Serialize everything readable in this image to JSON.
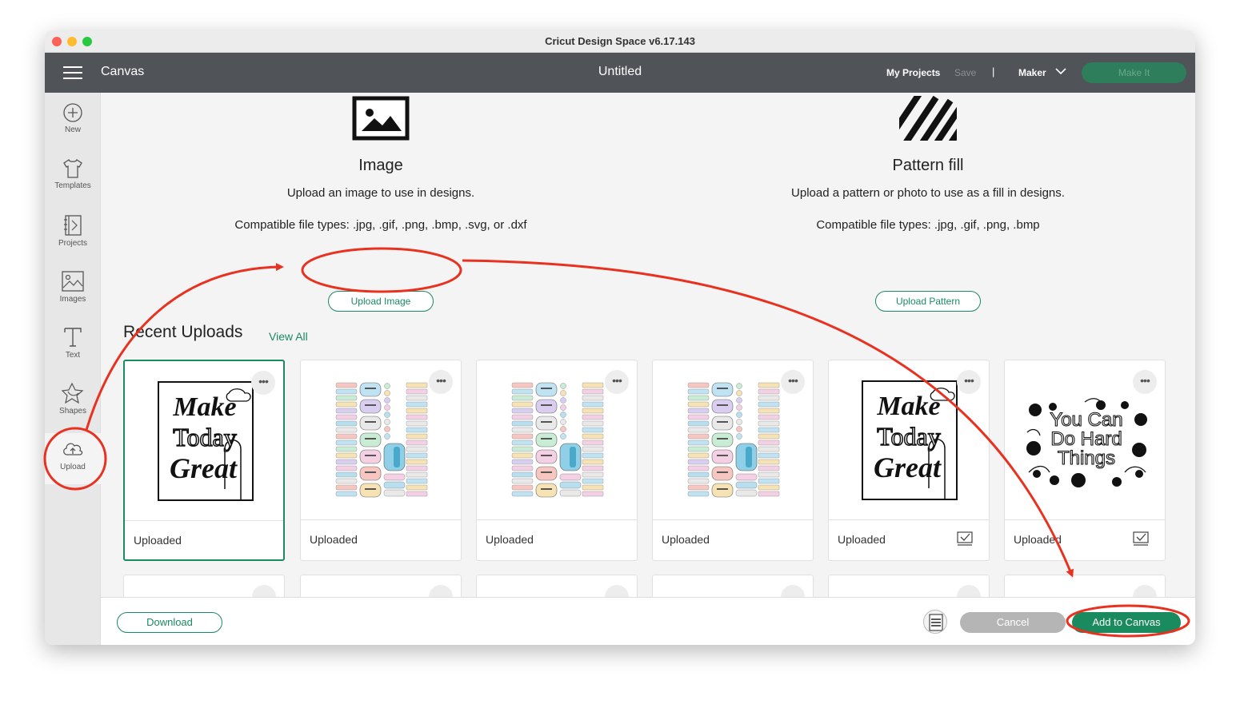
{
  "window": {
    "title": "Cricut Design Space  v6.17.143"
  },
  "header": {
    "section": "Canvas",
    "doc_title": "Untitled",
    "my_projects": "My Projects",
    "save": "Save",
    "separator": "|",
    "machine": "Maker",
    "make_it": "Make It"
  },
  "sidebar": {
    "items": [
      {
        "label": "New",
        "icon": "plus-circle-icon"
      },
      {
        "label": "Templates",
        "icon": "tshirt-icon"
      },
      {
        "label": "Projects",
        "icon": "projects-icon"
      },
      {
        "label": "Images",
        "icon": "images-icon"
      },
      {
        "label": "Text",
        "icon": "text-icon"
      },
      {
        "label": "Shapes",
        "icon": "shapes-icon"
      },
      {
        "label": "Upload",
        "icon": "cloud-upload-icon"
      }
    ]
  },
  "upload_image": {
    "title": "Image",
    "description": "Upload an image to use in designs.",
    "types": "Compatible file types: .jpg, .gif, .png, .bmp, .svg, or .dxf",
    "button": "Upload Image"
  },
  "upload_pattern": {
    "title": "Pattern fill",
    "description": "Upload a pattern or photo to use as a fill in designs.",
    "types": "Compatible file types: .jpg, .gif, .png, .bmp",
    "button": "Upload Pattern"
  },
  "recent": {
    "title": "Recent Uploads",
    "view_all": "View All",
    "tiles": [
      {
        "caption": "Uploaded",
        "art": "Make Today Great",
        "selected": true,
        "checkbox": false
      },
      {
        "caption": "Uploaded",
        "art": "planner stickers",
        "selected": false,
        "checkbox": false
      },
      {
        "caption": "Uploaded",
        "art": "planner stickers",
        "selected": false,
        "checkbox": false
      },
      {
        "caption": "Uploaded",
        "art": "planner stickers",
        "selected": false,
        "checkbox": false
      },
      {
        "caption": "Uploaded",
        "art": "Make Today Great",
        "selected": false,
        "checkbox": true
      },
      {
        "caption": "Uploaded",
        "art": "You Can Do Hard Things",
        "selected": false,
        "checkbox": true
      }
    ],
    "art_text": {
      "make": "Make",
      "today": "Today",
      "great": "Great",
      "you_can": "You Can",
      "do_hard": "Do Hard",
      "things": "Things"
    },
    "more_label": "•••"
  },
  "footer": {
    "download": "Download",
    "cancel": "Cancel",
    "add_to_canvas": "Add to Canvas"
  },
  "annotation_color": "#e8321f",
  "accent_color": "#1a8a5f"
}
